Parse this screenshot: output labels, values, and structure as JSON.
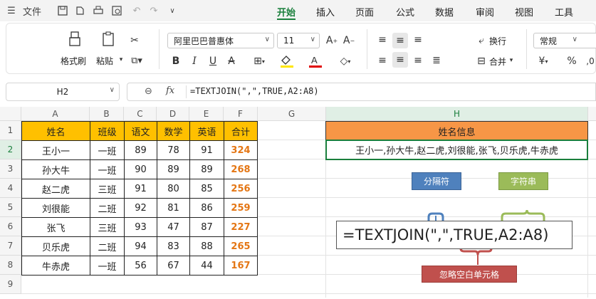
{
  "titlebar": {
    "file_label": "文件",
    "tabs": [
      "开始",
      "插入",
      "页面",
      "公式",
      "数据",
      "审阅",
      "视图",
      "工具"
    ],
    "active_tab": "开始"
  },
  "ribbon": {
    "format_painter": "格式刷",
    "paste": "粘贴",
    "font_name": "阿里巴巴普惠体",
    "font_size": "11",
    "wrap": "换行",
    "merge": "合并",
    "number_format": "常规",
    "currency": "¥",
    "percent": "%",
    "bold": "B",
    "italic": "I",
    "underline": "U"
  },
  "formula_bar": {
    "name_box": "H2",
    "fx": "fx",
    "formula": "=TEXTJOIN(\",\",TRUE,A2:A8)"
  },
  "columns": [
    "A",
    "B",
    "C",
    "D",
    "E",
    "F",
    "G",
    "H"
  ],
  "rows": [
    "1",
    "2",
    "3",
    "4",
    "5",
    "6",
    "7",
    "8",
    "9"
  ],
  "table": {
    "headers": [
      "姓名",
      "班级",
      "语文",
      "数学",
      "英语",
      "合计"
    ],
    "rows": [
      [
        "王小一",
        "一班",
        "89",
        "78",
        "91",
        "324"
      ],
      [
        "孙大牛",
        "一班",
        "90",
        "89",
        "89",
        "268"
      ],
      [
        "赵二虎",
        "三班",
        "91",
        "80",
        "85",
        "256"
      ],
      [
        "刘很能",
        "二班",
        "92",
        "81",
        "86",
        "259"
      ],
      [
        "张飞",
        "三班",
        "93",
        "47",
        "87",
        "227"
      ],
      [
        "贝乐虎",
        "二班",
        "94",
        "83",
        "88",
        "265"
      ],
      [
        "牛赤虎",
        "一班",
        "56",
        "67",
        "44",
        "167"
      ]
    ]
  },
  "result": {
    "header": "姓名信息",
    "value": "王小一,孙大牛,赵二虎,刘很能,张飞,贝乐虎,牛赤虎"
  },
  "annotations": {
    "delimiter": "分隔符",
    "string": "字符串",
    "ignore_empty": "忽略空白单元格",
    "formula": "=TEXTJOIN(\",\",TRUE,A2:A8)"
  },
  "colors": {
    "accent": "#1a7f3c",
    "header_yellow": "#ffc000",
    "header_orange": "#f79646",
    "total_orange": "#e47614",
    "note_blue": "#4f81bd",
    "note_green": "#9bbb59",
    "note_red": "#c0504d"
  }
}
